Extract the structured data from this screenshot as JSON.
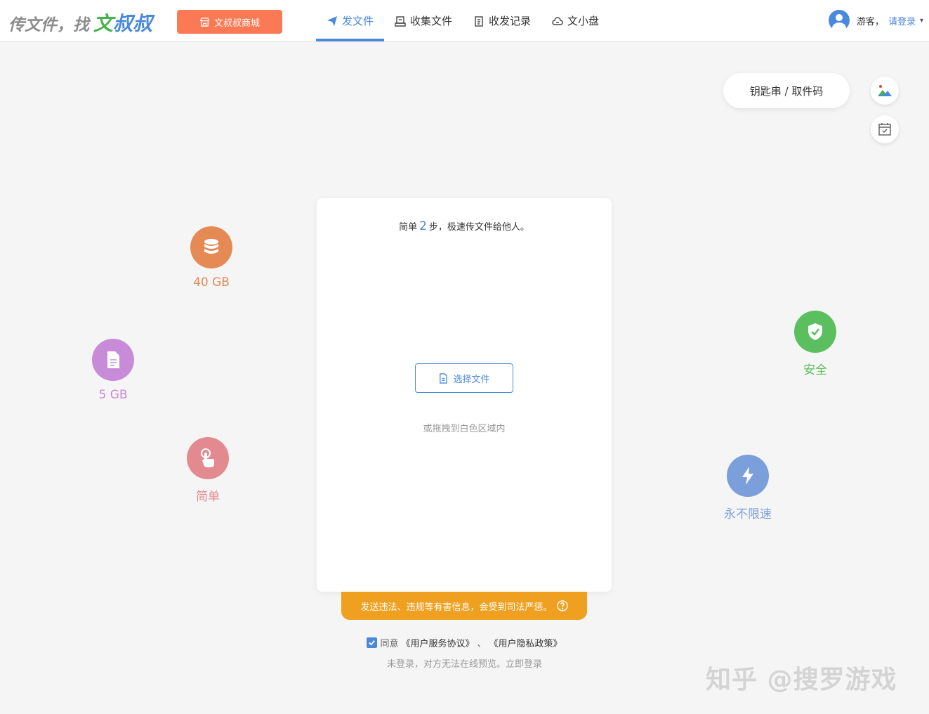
{
  "header": {
    "logo": {
      "part1": "传文件，找",
      "part2": "文",
      "part3": "叔叔"
    },
    "shop_button": "文叔叔商城",
    "nav": [
      {
        "label": "发文件",
        "icon": "paper-plane-icon",
        "active": true
      },
      {
        "label": "收集文件",
        "icon": "inbox-icon",
        "active": false
      },
      {
        "label": "收发记录",
        "icon": "clipboard-icon",
        "active": false
      },
      {
        "label": "文小盘",
        "icon": "cloud-drive-icon",
        "active": false
      }
    ],
    "user": {
      "guest_label": "游客，",
      "login_link": "请登录",
      "caret": "▾"
    }
  },
  "side_actions": {
    "key_button": "钥匙串 / 取件码",
    "image_button_icon": "landscape-image-icon",
    "calendar_button_icon": "calendar-check-icon"
  },
  "features": [
    {
      "label": "40 GB",
      "icon": "database-icon",
      "color": "#e58a55"
    },
    {
      "label": "5 GB",
      "icon": "document-icon",
      "color": "#c78bd8"
    },
    {
      "label": "简单",
      "icon": "hand-pointer-icon",
      "color": "#e38a90"
    },
    {
      "label": "安全",
      "icon": "shield-check-icon",
      "color": "#5cbf5f"
    },
    {
      "label": "永不限速",
      "icon": "lightning-icon",
      "color": "#7b9fdb"
    }
  ],
  "upload": {
    "steps_prefix": "简单",
    "steps_num": "2",
    "steps_suffix": "步，极速传文件给他人。",
    "choose_button": "选择文件",
    "drag_hint": "或拖拽到白色区域内"
  },
  "warning": "发送违法、违规等有害信息，会受到司法严惩。",
  "agreement": {
    "prefix": "同意",
    "doc1": "《用户服务协议》",
    "sep": "、",
    "doc2": "《用户隐私政策》",
    "checked": true
  },
  "not_login_note": "未登录，对方无法在线预览。立即登录",
  "watermark": "知乎 @搜罗游戏",
  "colors": {
    "accent": "#4a89dc",
    "shop": "#fb7a55",
    "warning": "#f0a020"
  }
}
